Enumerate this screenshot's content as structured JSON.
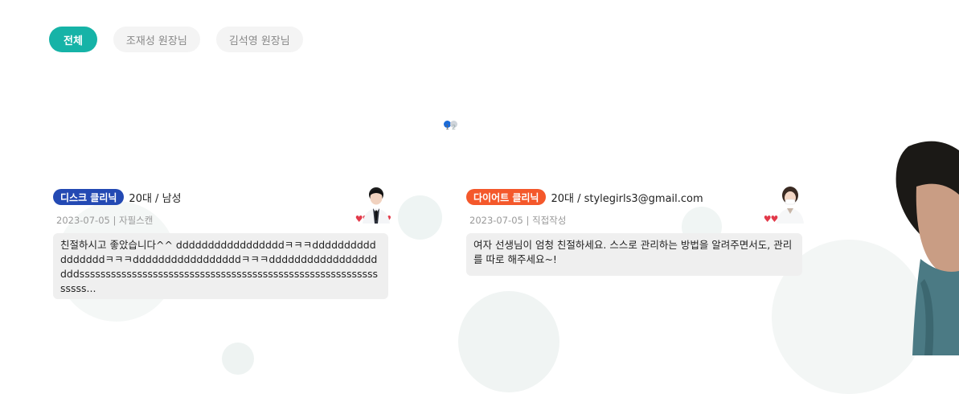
{
  "tabs": [
    {
      "label": "전체",
      "active": true
    },
    {
      "label": "조재성 원장님",
      "active": false
    },
    {
      "label": "김석영 원장님",
      "active": false
    }
  ],
  "pagination": {
    "current": "1",
    "total": "2"
  },
  "reviews": [
    {
      "clinic": "디스크 클리닉",
      "clinic_color": "#2349b3",
      "author": "20대 / 남성",
      "date_method": "2023-07-05 | 자필스캔",
      "rating": "♥♥♥♥♥",
      "rating_value": 5,
      "avatar_icon": "doctor-male-avatar-icon",
      "text": "친절하시고 좋았습니다^^ dddddddddddddddddㅋㅋㅋdddddddddddddddddㅋㅋㅋdddddddddddddddddㅋㅋㅋddddddddddddddddd dddssssssssssssssssssssssssssssssssssssssssssssssssssssssssssssss..."
    },
    {
      "clinic": "다이어트 클리닉",
      "clinic_color": "#f4582b",
      "author": "20대 / stylegirls3@gmail.com",
      "date_method": "2023-07-05 | 직접작성",
      "rating": "♥♥♥♥♥",
      "rating_value": 5,
      "avatar_icon": "doctor-female-avatar-icon",
      "text": "여자 선생님이 엄청 친절하세요. 스스로 관리하는 방법을 알려주면서도, 관리를 따로 해주세요~!"
    }
  ],
  "colors": {
    "accent": "#16b3a7",
    "pager_active": "#1b6bd9",
    "heart": "#e23a4a"
  }
}
